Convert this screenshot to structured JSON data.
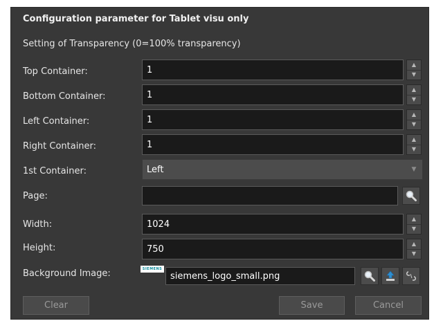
{
  "dialog": {
    "title": "Configuration parameter for Tablet visu only",
    "transparency_heading": "Setting of Transparency (0=100% transparency)"
  },
  "fields": {
    "top_container": {
      "label": "Top Container:",
      "value": "1"
    },
    "bottom_container": {
      "label": "Bottom Container:",
      "value": "1"
    },
    "left_container": {
      "label": "Left Container:",
      "value": "1"
    },
    "right_container": {
      "label": "Right Container:",
      "value": "1"
    },
    "first_container": {
      "label": "1st Container:",
      "value": "Left"
    },
    "page": {
      "label": "Page:",
      "value": ""
    },
    "width": {
      "label": "Width:",
      "value": "1024"
    },
    "height": {
      "label": "Height:",
      "value": "750"
    },
    "background_image": {
      "label": "Background Image:",
      "value": "siemens_logo_small.png",
      "thumbnail_text": "SIEMENS"
    }
  },
  "icons": {
    "spinner_up": "▲",
    "spinner_down": "▼",
    "dropdown": "▼"
  },
  "buttons": {
    "clear": "Clear",
    "save": "Save",
    "cancel": "Cancel"
  }
}
